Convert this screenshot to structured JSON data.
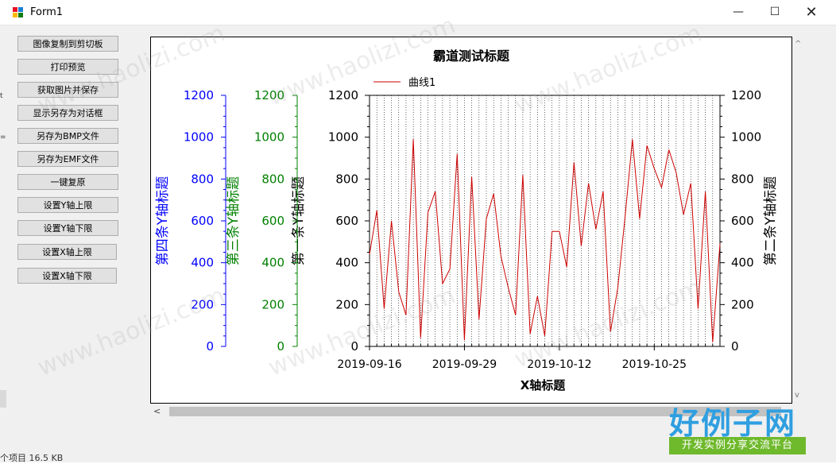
{
  "window": {
    "title": "Form1"
  },
  "window_controls": {
    "minimize": "—",
    "maximize": "☐",
    "close": "✕"
  },
  "buttons": [
    "图像复制到剪切板",
    "打印预览",
    "获取图片并保存",
    "显示另存为对话框",
    "另存为BMP文件",
    "另存为EMF文件",
    "一键复原",
    "设置Y轴上限",
    "设置Y轴下限",
    "设置X轴上限",
    "设置X轴下限"
  ],
  "status": {
    "fragment": "个项目 16.5 KB"
  },
  "left_marks": {
    "a": "t",
    "b": "="
  },
  "scroll": {
    "left": "<",
    "up": "^",
    "down": "v"
  },
  "watermark": {
    "text": "www.haolizi.com"
  },
  "logo": {
    "main": "好例子网",
    "sub": "开发实例分享交流平台"
  },
  "colors": {
    "curve": "#cc0000",
    "axis4": "#0000ff",
    "axis3": "#008000",
    "axis1": "#000000",
    "axis2": "#000000"
  },
  "chart_data": {
    "type": "line",
    "title": "霸道测试标题",
    "xlabel": "X轴标题",
    "x_ticks": [
      "2019-09-16",
      "2019-09-29",
      "2019-10-12",
      "2019-10-25"
    ],
    "x_range": [
      "2019-09-16",
      "2019-11-03"
    ],
    "legend": {
      "position": "top-left",
      "entries": [
        "曲线1"
      ]
    },
    "y_axes": [
      {
        "label": "第一条Y轴标题",
        "range": [
          0,
          1200
        ],
        "ticks": [
          "0",
          "200",
          "400",
          "600",
          "800",
          "1000",
          "1200"
        ],
        "color": "#000000",
        "side": "left"
      },
      {
        "label": "第二条Y轴标题",
        "range": [
          0,
          1200
        ],
        "ticks": [
          "0",
          "200",
          "400",
          "600",
          "800",
          "1000",
          "1200"
        ],
        "color": "#000000",
        "side": "right"
      },
      {
        "label": "第三条Y轴标题",
        "range": [
          0,
          1200
        ],
        "ticks": [
          "0",
          "200",
          "400",
          "600",
          "800",
          "1000",
          "1200"
        ],
        "color": "#008000",
        "side": "left"
      },
      {
        "label": "第四条Y轴标题",
        "range": [
          0,
          1200
        ],
        "ticks": [
          "0",
          "200",
          "400",
          "600",
          "800",
          "1000",
          "1200"
        ],
        "color": "#0000ff",
        "side": "left"
      }
    ],
    "grid": {
      "x_vertical_dotted": true
    },
    "series": [
      {
        "name": "曲线1",
        "color": "#cc0000",
        "x": [
          "2019-09-16",
          "2019-09-17",
          "2019-09-18",
          "2019-09-19",
          "2019-09-20",
          "2019-09-21",
          "2019-09-22",
          "2019-09-23",
          "2019-09-24",
          "2019-09-25",
          "2019-09-26",
          "2019-09-27",
          "2019-09-28",
          "2019-09-29",
          "2019-09-30",
          "2019-10-01",
          "2019-10-02",
          "2019-10-03",
          "2019-10-04",
          "2019-10-05",
          "2019-10-06",
          "2019-10-07",
          "2019-10-08",
          "2019-10-09",
          "2019-10-10",
          "2019-10-11",
          "2019-10-12",
          "2019-10-13",
          "2019-10-14",
          "2019-10-15",
          "2019-10-16",
          "2019-10-17",
          "2019-10-18",
          "2019-10-19",
          "2019-10-20",
          "2019-10-21",
          "2019-10-22",
          "2019-10-23",
          "2019-10-24",
          "2019-10-25",
          "2019-10-26",
          "2019-10-27",
          "2019-10-28",
          "2019-10-29",
          "2019-10-30",
          "2019-10-31",
          "2019-11-01",
          "2019-11-02",
          "2019-11-03"
        ],
        "y": [
          440,
          650,
          180,
          600,
          260,
          150,
          990,
          40,
          640,
          740,
          300,
          370,
          920,
          30,
          810,
          130,
          610,
          730,
          430,
          280,
          150,
          820,
          60,
          240,
          50,
          550,
          550,
          380,
          880,
          480,
          780,
          560,
          740,
          70,
          280,
          620,
          990,
          610,
          960,
          850,
          760,
          940,
          830,
          630,
          780,
          180,
          740,
          20,
          490
        ]
      }
    ]
  }
}
